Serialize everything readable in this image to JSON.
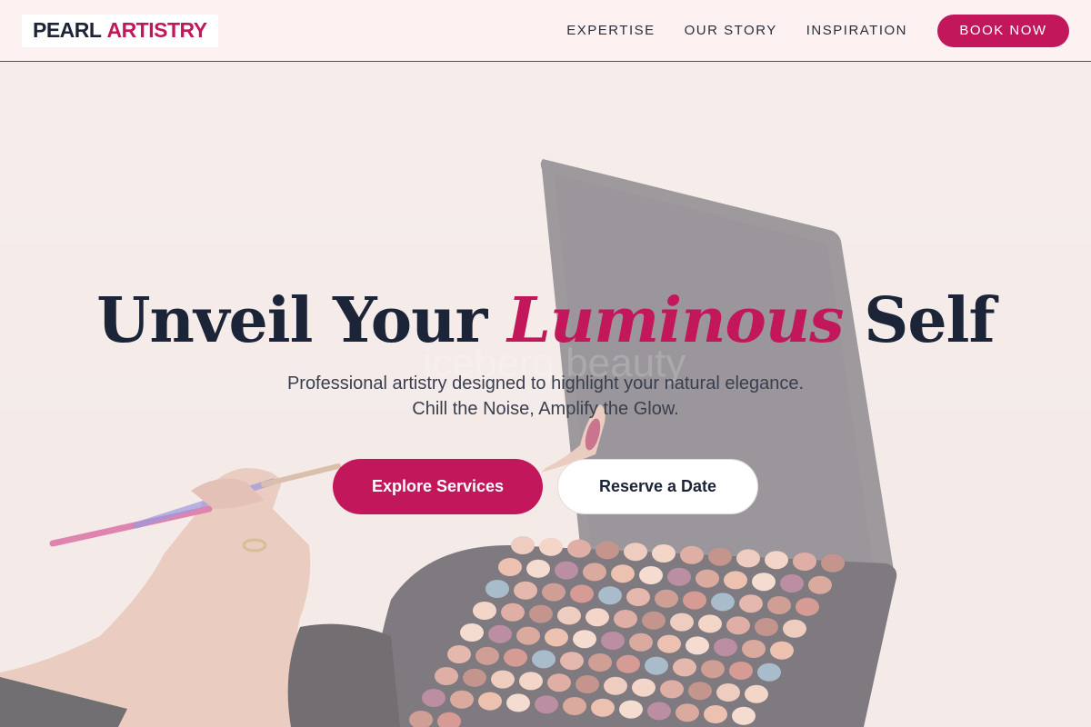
{
  "brand": {
    "name_part1": "PEARL",
    "name_part2": "ARTISTRY"
  },
  "nav": {
    "links": [
      "EXPERTISE",
      "OUR STORY",
      "INSPIRATION"
    ],
    "cta_label": "BOOK NOW"
  },
  "hero": {
    "headline_part1": "Unveil Your",
    "headline_accent": "Luminous",
    "headline_part2": "Self",
    "subtext_line1": "Professional artistry designed to highlight your natural elegance.",
    "subtext_line2": "Chill the Noise, Amplify the Glow.",
    "primary_button": "Explore Services",
    "secondary_button": "Reserve a Date",
    "background_watermark": "iceberg beauty"
  },
  "colors": {
    "accent": "#c2185b",
    "dark": "#1c2438",
    "header_bg": "#fdf1f2"
  }
}
